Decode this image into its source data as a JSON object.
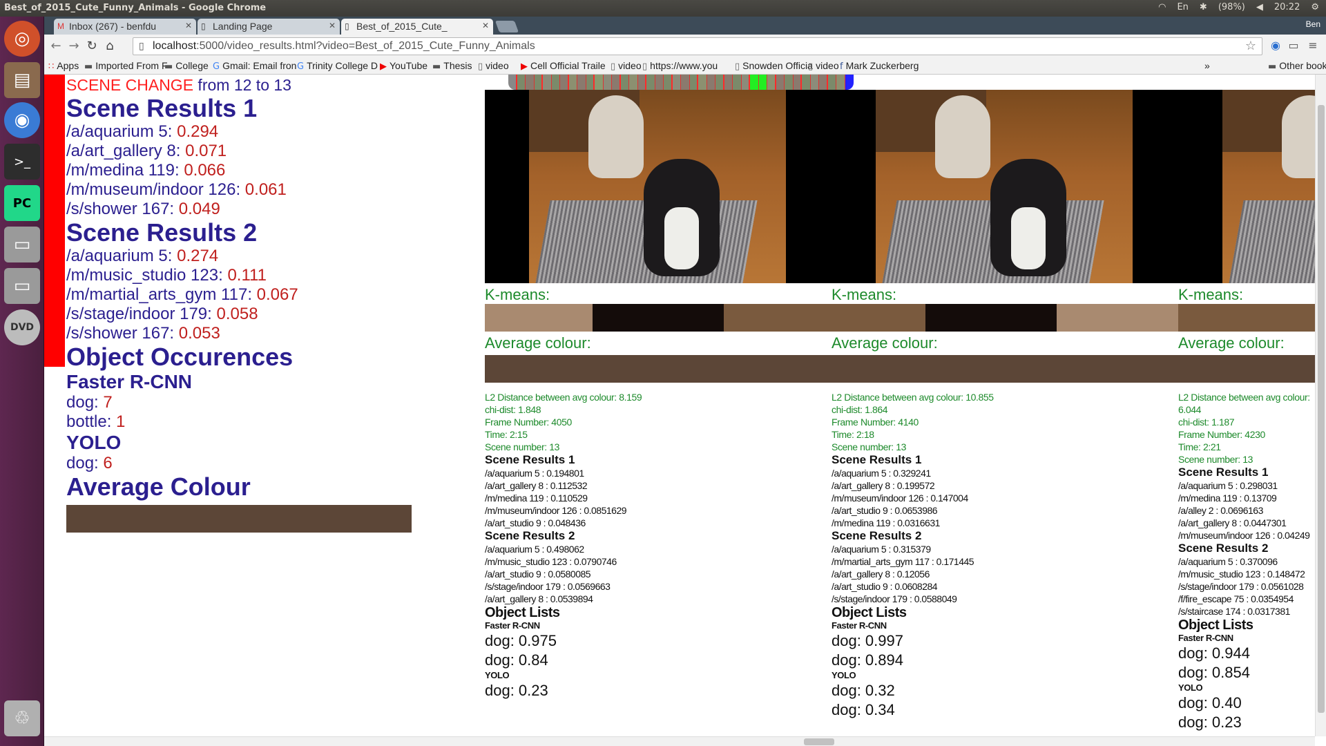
{
  "window": {
    "title": "Best_of_2015_Cute_Funny_Animals - Google Chrome",
    "indicators": {
      "keyboard": "En",
      "battery": "(98%)",
      "time": "20:22"
    }
  },
  "launcher": [
    "ubuntu-icon",
    "files-icon",
    "chrome-icon",
    "terminal-icon",
    "pycharm-icon",
    "drive-icon",
    "drive-icon",
    "dvd-icon",
    "trash-icon"
  ],
  "tabs": [
    {
      "label": "Inbox (267) - benfdu",
      "icon": "gmail-icon"
    },
    {
      "label": "Landing Page",
      "icon": "page-icon"
    },
    {
      "label": "Best_of_2015_Cute_",
      "icon": "page-icon"
    }
  ],
  "user": "Ben",
  "url": {
    "host": "localhost",
    "rest": ":5000/video_results.html?video=Best_of_2015_Cute_Funny_Animals"
  },
  "bookmarks": [
    {
      "label": "Apps",
      "icon": "apps-icon"
    },
    {
      "label": "Imported From F",
      "icon": "folder-icon"
    },
    {
      "label": "College",
      "icon": "folder-icon"
    },
    {
      "label": "Gmail: Email fron",
      "icon": "google-icon"
    },
    {
      "label": "Trinity College D",
      "icon": "google-icon"
    },
    {
      "label": "YouTube",
      "icon": "youtube-icon"
    },
    {
      "label": "Thesis",
      "icon": "folder-icon"
    },
    {
      "label": "video",
      "icon": "page-icon"
    },
    {
      "label": "Cell Official Traile",
      "icon": "youtube-icon"
    },
    {
      "label": "video",
      "icon": "page-icon"
    },
    {
      "label": "https://www.you",
      "icon": "page-icon"
    },
    {
      "label": "Snowden Officia",
      "icon": "page-icon"
    },
    {
      "label": "video",
      "icon": "page-icon"
    },
    {
      "label": "Mark Zuckerberg",
      "icon": "facebook-icon"
    },
    {
      "label": "»",
      "icon": ""
    },
    {
      "label": "Other bookmarks",
      "icon": "folder-icon"
    }
  ],
  "left": {
    "change_prefix": "SCENE CHANGE",
    "change_suffix": " from 12 to 13",
    "scene1_title": "Scene Results 1",
    "scene1": [
      {
        "name": "/a/aquarium 5: ",
        "val": "0.294"
      },
      {
        "name": "/a/art_gallery 8: ",
        "val": "0.071"
      },
      {
        "name": "/m/medina 119: ",
        "val": "0.066"
      },
      {
        "name": "/m/museum/indoor 126: ",
        "val": "0.061"
      },
      {
        "name": "/s/shower 167: ",
        "val": "0.049"
      }
    ],
    "scene2_title": "Scene Results 2",
    "scene2": [
      {
        "name": "/a/aquarium 5: ",
        "val": "0.274"
      },
      {
        "name": "/m/music_studio 123: ",
        "val": "0.111"
      },
      {
        "name": "/m/martial_arts_gym 117: ",
        "val": "0.067"
      },
      {
        "name": "/s/stage/indoor 179: ",
        "val": "0.058"
      },
      {
        "name": "/s/shower 167: ",
        "val": "0.053"
      }
    ],
    "objects_title": "Object Occurences",
    "frcnn_title": "Faster R-CNN",
    "frcnn": [
      {
        "name": "dog: ",
        "val": "7"
      },
      {
        "name": "bottle: ",
        "val": "1"
      }
    ],
    "yolo_title": "YOLO",
    "yolo": [
      {
        "name": "dog: ",
        "val": "6"
      }
    ],
    "avg_title": "Average Colour",
    "avg_color": "#5c4637"
  },
  "timeline_colors": [
    "#8a7a6e",
    "#7b8a6a",
    "#8a7a6e",
    "#7b8a6a",
    "#8c8c7a",
    "#7b8a6a",
    "#8a7a6e",
    "#8c9070",
    "#8a7a6e",
    "#7b8a6a",
    "#8a9a70",
    "#8c8c7a",
    "#8a7a6e",
    "#7b8a6a",
    "#8c9070",
    "#8a7a6e",
    "#7b8a6a",
    "#8a7a6e",
    "#7b8a6a",
    "#8c8c7a",
    "#8a7a6e",
    "#7b8a6a",
    "#8c9070",
    "#8a7a6e",
    "#7b8a6a",
    "#8a7a6e",
    "#7b8a6a",
    "#8c8c7a",
    "#8a7a6e",
    "#7b8a6a",
    "#8c9070",
    "#8a7a6e",
    "#7b8a6a",
    "#8a7a6e",
    "#7b8a6a",
    "#8c8c7a",
    "#8a7a6e",
    "#7b8a6a",
    "#8c9070",
    "#8a7a6e"
  ],
  "frames": [
    {
      "kmeans_label": "K-means:",
      "kmeans": [
        {
          "c": "#a98a70",
          "w": 31
        },
        {
          "c": "#140c0a",
          "w": 38
        },
        {
          "c": "#7a5a3e",
          "w": 31
        }
      ],
      "avg_label": "Average colour:",
      "l2": "L2 Distance between avg colour: 8.159",
      "chi": "chi-dist: 1.848",
      "frame": "Frame Number: 4050",
      "time": "Time: 2:15",
      "scene": "Scene number: 13",
      "sr1_title": "Scene Results 1",
      "sr1": [
        "/a/aquarium 5 : 0.194801",
        "/a/art_gallery 8 : 0.112532",
        "/m/medina 119 : 0.110529",
        "/m/museum/indoor 126 : 0.0851629",
        "/a/art_studio 9 : 0.048436"
      ],
      "sr2_title": "Scene Results 2",
      "sr2": [
        "/a/aquarium 5 : 0.498062",
        "/m/music_studio 123 : 0.0790746",
        "/a/art_studio 9 : 0.0580085",
        "/s/stage/indoor 179 : 0.0569663",
        "/a/art_gallery 8 : 0.0539894"
      ],
      "ol_title": "Object Lists",
      "frcnn_title": "Faster R-CNN",
      "frcnn": [
        "dog: 0.975",
        "dog: 0.84"
      ],
      "yolo_title": "YOLO",
      "yolo": [
        "dog: 0.23"
      ]
    },
    {
      "kmeans_label": "K-means:",
      "kmeans": [
        {
          "c": "#7a5a3e",
          "w": 27
        },
        {
          "c": "#140c0a",
          "w": 38
        },
        {
          "c": "#a98a70",
          "w": 35
        }
      ],
      "avg_label": "Average colour:",
      "l2": "L2 Distance between avg colour: 10.855",
      "chi": "chi-dist: 1.864",
      "frame": "Frame Number: 4140",
      "time": "Time: 2:18",
      "scene": "Scene number: 13",
      "sr1_title": "Scene Results 1",
      "sr1": [
        "/a/aquarium 5 : 0.329241",
        "/a/art_gallery 8 : 0.199572",
        "/m/museum/indoor 126 : 0.147004",
        "/a/art_studio 9 : 0.0653986",
        "/m/medina 119 : 0.0316631"
      ],
      "sr2_title": "Scene Results 2",
      "sr2": [
        "/a/aquarium 5 : 0.315379",
        "/m/martial_arts_gym 117 : 0.171445",
        "/a/art_gallery 8 : 0.12056",
        "/a/art_studio 9 : 0.0608284",
        "/s/stage/indoor 179 : 0.0588049"
      ],
      "ol_title": "Object Lists",
      "frcnn_title": "Faster R-CNN",
      "frcnn": [
        "dog: 0.997",
        "dog: 0.894"
      ],
      "yolo_title": "YOLO",
      "yolo": [
        "dog: 0.32",
        "dog: 0.34"
      ]
    },
    {
      "kmeans_label": "K-means:",
      "kmeans": [
        {
          "c": "#7a5a3e",
          "w": 82
        },
        {
          "c": "#a98a70",
          "w": 18
        }
      ],
      "avg_label": "Average colour:",
      "l2": "L2 Distance between avg colour: 6.044",
      "chi": "chi-dist: 1.187",
      "frame": "Frame Number: 4230",
      "time": "Time: 2:21",
      "scene": "Scene number: 13",
      "sr1_title": "Scene Results 1",
      "sr1": [
        "/a/aquarium 5 : 0.298031",
        "/m/medina 119 : 0.13709",
        "/a/alley 2 : 0.0696163",
        "/a/art_gallery 8 : 0.0447301",
        "/m/museum/indoor 126 : 0.04249"
      ],
      "sr2_title": "Scene Results 2",
      "sr2": [
        "/a/aquarium 5 : 0.370096",
        "/m/music_studio 123 : 0.148472",
        "/s/stage/indoor 179 : 0.0561028",
        "/f/fire_escape 75 : 0.0354954",
        "/s/staircase 174 : 0.0317381"
      ],
      "ol_title": "Object Lists",
      "frcnn_title": "Faster R-CNN",
      "frcnn": [
        "dog: 0.944",
        "dog: 0.854"
      ],
      "yolo_title": "YOLO",
      "yolo": [
        "dog: 0.40",
        "dog: 0.23"
      ]
    }
  ]
}
